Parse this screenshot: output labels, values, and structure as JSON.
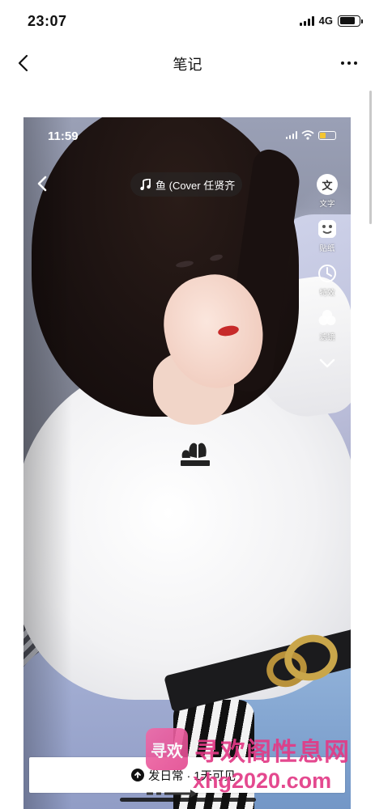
{
  "status_bar": {
    "time": "23:07",
    "network": "4G"
  },
  "nav": {
    "title": "笔记"
  },
  "post_image": {
    "inner_status": {
      "time": "11:59"
    },
    "music_chip": {
      "text": "鱼 (Cover 任贤齐"
    },
    "tools": [
      {
        "label": "文字",
        "icon": "text-icon",
        "glyph": "文"
      },
      {
        "label": "贴纸",
        "icon": "sticker-icon"
      },
      {
        "label": "特效",
        "icon": "effects-icon"
      },
      {
        "label": "滤镜",
        "icon": "filter-icon"
      }
    ],
    "publish": {
      "label": "发日常 · 1天可见"
    }
  },
  "watermark": {
    "logo_text": "寻欢",
    "title": "寻欢阁性息网",
    "url": "xhg2020.com"
  }
}
